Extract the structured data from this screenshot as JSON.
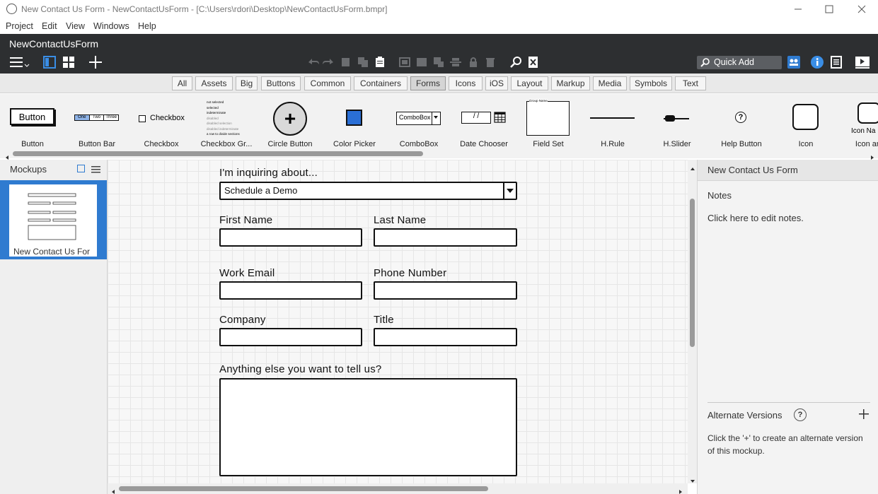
{
  "window": {
    "title": "New Contact Us Form - NewContactUsForm - [C:\\Users\\rdori\\Desktop\\NewContactUsForm.bmpr]",
    "minimize_icon": "minimize-icon",
    "maximize_icon": "maximize-icon",
    "close_icon": "close-icon"
  },
  "menu": [
    "Project",
    "Edit",
    "View",
    "Windows",
    "Help"
  ],
  "project": {
    "name": "NewContactUsForm",
    "quick_add_placeholder": "Quick Add"
  },
  "categories": [
    "All",
    "Assets",
    "Big",
    "Buttons",
    "Common",
    "Containers",
    "Forms",
    "Icons",
    "iOS",
    "Layout",
    "Markup",
    "Media",
    "Symbols",
    "Text"
  ],
  "active_category": "Forms",
  "palette": {
    "items": [
      {
        "label": "Button",
        "preview": "Button"
      },
      {
        "label": "Button Bar",
        "preview_tabs": [
          "One",
          "Two",
          "Three"
        ]
      },
      {
        "label": "Checkbox",
        "preview": "Checkbox"
      },
      {
        "label": "Checkbox Gr...",
        "preview_lines": [
          "not selected",
          "selected",
          "indeterminate",
          "disabled",
          "disabled selection",
          "disabled indeterminate",
          "a row to divide sections"
        ]
      },
      {
        "label": "Circle Button",
        "preview": "+"
      },
      {
        "label": "Color Picker"
      },
      {
        "label": "ComboBox",
        "preview": "ComboBox"
      },
      {
        "label": "Date Chooser",
        "preview": "/ /"
      },
      {
        "label": "Field Set",
        "preview": "Group Name"
      },
      {
        "label": "H.Rule"
      },
      {
        "label": "H.Slider"
      },
      {
        "label": "Help Button",
        "preview": "?"
      },
      {
        "label": "Icon"
      },
      {
        "label": "Icon and",
        "preview": "Icon Na"
      }
    ]
  },
  "mockups_panel": {
    "title": "Mockups",
    "items": [
      {
        "label": "New Contact Us For"
      }
    ]
  },
  "form": {
    "inquiry_label": "I'm inquiring about...",
    "inquiry_value": "Schedule a Demo",
    "first_name_label": "First Name",
    "last_name_label": "Last Name",
    "work_email_label": "Work Email",
    "phone_label": "Phone Number",
    "company_label": "Company",
    "title_label": "Title",
    "message_label": "Anything else you want to tell us?"
  },
  "right_panel": {
    "title": "New Contact Us Form",
    "notes_heading": "Notes",
    "notes_placeholder": "Click here to edit notes.",
    "alt_versions_heading": "Alternate Versions",
    "alt_versions_help": "Click the '+' to create an alternate version of this mockup."
  },
  "colors": {
    "project_bar": "#2d2f31",
    "selected_mockup": "#2f7bd0",
    "color_picker_swatch": "#2a6fd6"
  }
}
